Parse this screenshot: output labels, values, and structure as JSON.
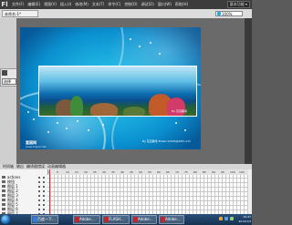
{
  "app": {
    "icon_letter": "Fl"
  },
  "menubar": {
    "items": [
      "文件(F)",
      "编辑(E)",
      "视图(V)",
      "插入(I)",
      "修改(M)",
      "文本(T)",
      "命令(C)",
      "控制(O)",
      "调试(D)",
      "窗口(W)",
      "帮助(H)"
    ],
    "workspace": "基本功能 ▾"
  },
  "document": {
    "tab": "未命名-1*",
    "scene": "场景 1",
    "zoom": "100%"
  },
  "tools": {
    "selection_label": "选择"
  },
  "stage": {
    "caption_left": "富国网",
    "caption_left_sub": "www.fuguo.net",
    "caption_right": "By 花自飘零 Email:12345@163.com",
    "photo_signature": "By 花自飘零"
  },
  "timeline": {
    "tabs": [
      "时间轴",
      "输出",
      "编译器错误",
      "动画编辑器"
    ],
    "ruler": [
      "1",
      "5",
      "10",
      "15",
      "20",
      "25",
      "30",
      "35",
      "40",
      "45",
      "50",
      "55",
      "60",
      "65",
      "70",
      "75",
      "80",
      "85",
      "90",
      "95",
      "100",
      "105"
    ],
    "layers": [
      "actions",
      "按钮",
      "图层 1",
      "图层 2",
      "图层 3",
      "图层 4",
      "图层 5",
      "图层 6",
      "图层 7"
    ]
  },
  "taskbar": {
    "buttons": [
      "百度一下...",
      "Adobe...",
      "FLASH...",
      "Adobe...",
      "Adobe..."
    ],
    "time": "10:47",
    "date": "2013/1/3"
  },
  "colors": {
    "stage_accent": "#0a8fcf",
    "playhead": "#d62b2b",
    "taskbar": "#1c3d63"
  }
}
